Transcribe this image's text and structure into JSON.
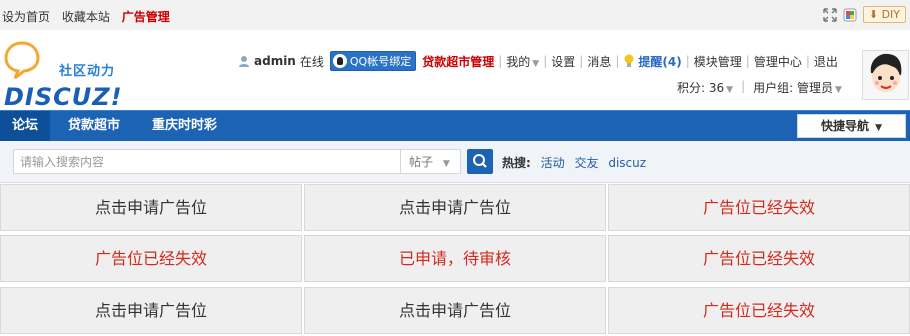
{
  "topbar": {
    "set_home": "设为首页",
    "bookmark": "收藏本站",
    "ad_manage": "广告管理",
    "diy": "DIY"
  },
  "logo": {
    "slogan": "社区动力",
    "word": "DISCUZ!"
  },
  "userbar": {
    "username": "admin",
    "online": "在线",
    "qq_bind": "QQ帐号绑定",
    "loan_manage": "贷款超市管理",
    "mine": "我的",
    "settings": "设置",
    "messages": "消息",
    "reminder": "提醒(4)",
    "module_manage": "模块管理",
    "admin_center": "管理中心",
    "logout": "退出"
  },
  "stats": {
    "points": "积分: 36",
    "usergroup": "用户组: 管理员"
  },
  "nav": {
    "tabs": [
      "论坛",
      "贷款超市",
      "重庆时时彩"
    ],
    "quick_nav": "快捷导航"
  },
  "search": {
    "placeholder": "请输入搜索内容",
    "type": "帖子",
    "hot_label": "热搜:",
    "hot_keywords": [
      "活动",
      "交友",
      "discuz"
    ]
  },
  "ad_slots": [
    [
      "点击申请广告位",
      "点击申请广告位",
      "广告位已经失效"
    ],
    [
      "广告位已经失效",
      "已申请，待审核",
      "广告位已经失效"
    ],
    [
      "点击申请广告位",
      "点击申请广告位",
      "广告位已经失效"
    ]
  ],
  "colors": {
    "nav_blue": "#1c63b4",
    "ad_red": "#d32a1f"
  }
}
